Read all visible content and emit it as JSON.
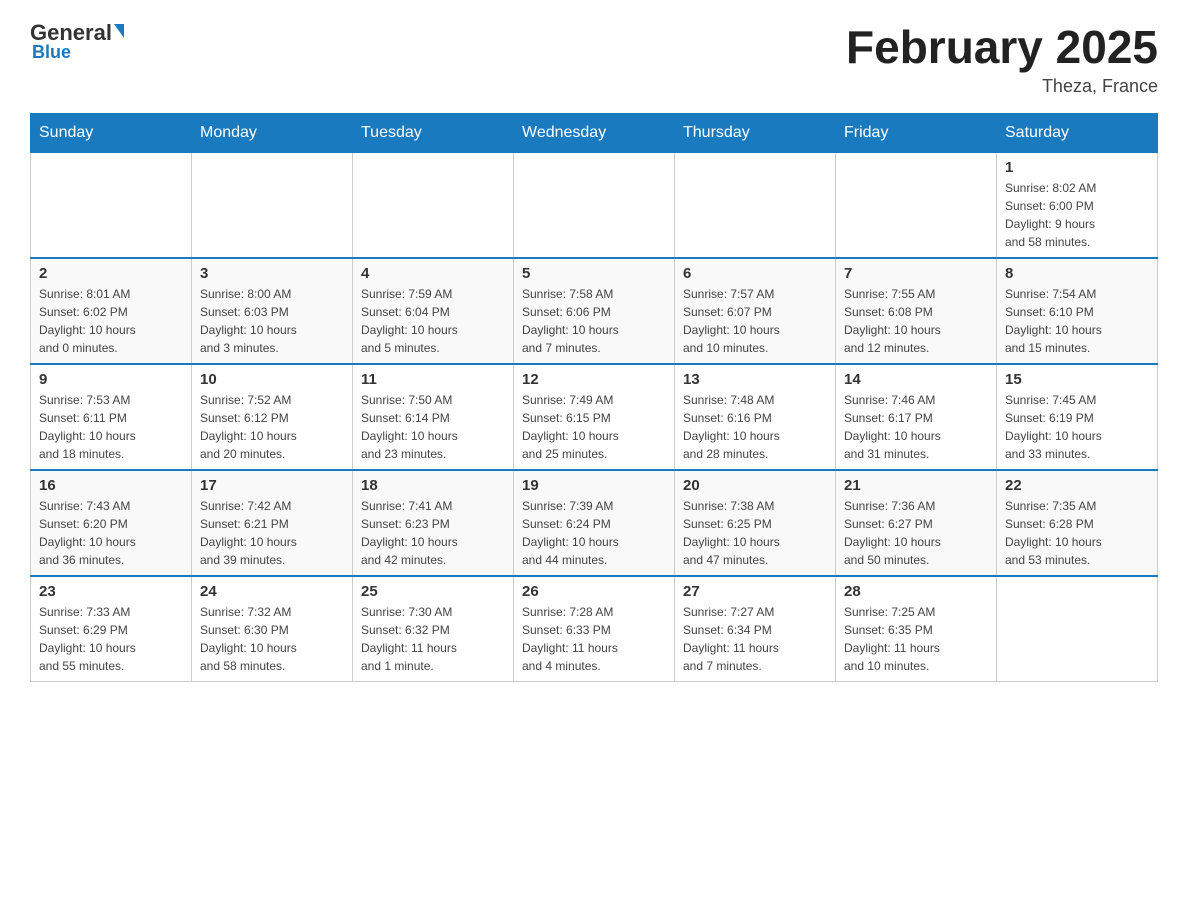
{
  "header": {
    "logo_general": "General",
    "logo_blue": "Blue",
    "month_title": "February 2025",
    "location": "Theza, France"
  },
  "days_of_week": [
    "Sunday",
    "Monday",
    "Tuesday",
    "Wednesday",
    "Thursday",
    "Friday",
    "Saturday"
  ],
  "weeks": [
    {
      "days": [
        {
          "num": "",
          "info": ""
        },
        {
          "num": "",
          "info": ""
        },
        {
          "num": "",
          "info": ""
        },
        {
          "num": "",
          "info": ""
        },
        {
          "num": "",
          "info": ""
        },
        {
          "num": "",
          "info": ""
        },
        {
          "num": "1",
          "info": "Sunrise: 8:02 AM\nSunset: 6:00 PM\nDaylight: 9 hours\nand 58 minutes."
        }
      ]
    },
    {
      "days": [
        {
          "num": "2",
          "info": "Sunrise: 8:01 AM\nSunset: 6:02 PM\nDaylight: 10 hours\nand 0 minutes."
        },
        {
          "num": "3",
          "info": "Sunrise: 8:00 AM\nSunset: 6:03 PM\nDaylight: 10 hours\nand 3 minutes."
        },
        {
          "num": "4",
          "info": "Sunrise: 7:59 AM\nSunset: 6:04 PM\nDaylight: 10 hours\nand 5 minutes."
        },
        {
          "num": "5",
          "info": "Sunrise: 7:58 AM\nSunset: 6:06 PM\nDaylight: 10 hours\nand 7 minutes."
        },
        {
          "num": "6",
          "info": "Sunrise: 7:57 AM\nSunset: 6:07 PM\nDaylight: 10 hours\nand 10 minutes."
        },
        {
          "num": "7",
          "info": "Sunrise: 7:55 AM\nSunset: 6:08 PM\nDaylight: 10 hours\nand 12 minutes."
        },
        {
          "num": "8",
          "info": "Sunrise: 7:54 AM\nSunset: 6:10 PM\nDaylight: 10 hours\nand 15 minutes."
        }
      ]
    },
    {
      "days": [
        {
          "num": "9",
          "info": "Sunrise: 7:53 AM\nSunset: 6:11 PM\nDaylight: 10 hours\nand 18 minutes."
        },
        {
          "num": "10",
          "info": "Sunrise: 7:52 AM\nSunset: 6:12 PM\nDaylight: 10 hours\nand 20 minutes."
        },
        {
          "num": "11",
          "info": "Sunrise: 7:50 AM\nSunset: 6:14 PM\nDaylight: 10 hours\nand 23 minutes."
        },
        {
          "num": "12",
          "info": "Sunrise: 7:49 AM\nSunset: 6:15 PM\nDaylight: 10 hours\nand 25 minutes."
        },
        {
          "num": "13",
          "info": "Sunrise: 7:48 AM\nSunset: 6:16 PM\nDaylight: 10 hours\nand 28 minutes."
        },
        {
          "num": "14",
          "info": "Sunrise: 7:46 AM\nSunset: 6:17 PM\nDaylight: 10 hours\nand 31 minutes."
        },
        {
          "num": "15",
          "info": "Sunrise: 7:45 AM\nSunset: 6:19 PM\nDaylight: 10 hours\nand 33 minutes."
        }
      ]
    },
    {
      "days": [
        {
          "num": "16",
          "info": "Sunrise: 7:43 AM\nSunset: 6:20 PM\nDaylight: 10 hours\nand 36 minutes."
        },
        {
          "num": "17",
          "info": "Sunrise: 7:42 AM\nSunset: 6:21 PM\nDaylight: 10 hours\nand 39 minutes."
        },
        {
          "num": "18",
          "info": "Sunrise: 7:41 AM\nSunset: 6:23 PM\nDaylight: 10 hours\nand 42 minutes."
        },
        {
          "num": "19",
          "info": "Sunrise: 7:39 AM\nSunset: 6:24 PM\nDaylight: 10 hours\nand 44 minutes."
        },
        {
          "num": "20",
          "info": "Sunrise: 7:38 AM\nSunset: 6:25 PM\nDaylight: 10 hours\nand 47 minutes."
        },
        {
          "num": "21",
          "info": "Sunrise: 7:36 AM\nSunset: 6:27 PM\nDaylight: 10 hours\nand 50 minutes."
        },
        {
          "num": "22",
          "info": "Sunrise: 7:35 AM\nSunset: 6:28 PM\nDaylight: 10 hours\nand 53 minutes."
        }
      ]
    },
    {
      "days": [
        {
          "num": "23",
          "info": "Sunrise: 7:33 AM\nSunset: 6:29 PM\nDaylight: 10 hours\nand 55 minutes."
        },
        {
          "num": "24",
          "info": "Sunrise: 7:32 AM\nSunset: 6:30 PM\nDaylight: 10 hours\nand 58 minutes."
        },
        {
          "num": "25",
          "info": "Sunrise: 7:30 AM\nSunset: 6:32 PM\nDaylight: 11 hours\nand 1 minute."
        },
        {
          "num": "26",
          "info": "Sunrise: 7:28 AM\nSunset: 6:33 PM\nDaylight: 11 hours\nand 4 minutes."
        },
        {
          "num": "27",
          "info": "Sunrise: 7:27 AM\nSunset: 6:34 PM\nDaylight: 11 hours\nand 7 minutes."
        },
        {
          "num": "28",
          "info": "Sunrise: 7:25 AM\nSunset: 6:35 PM\nDaylight: 11 hours\nand 10 minutes."
        },
        {
          "num": "",
          "info": ""
        }
      ]
    }
  ]
}
